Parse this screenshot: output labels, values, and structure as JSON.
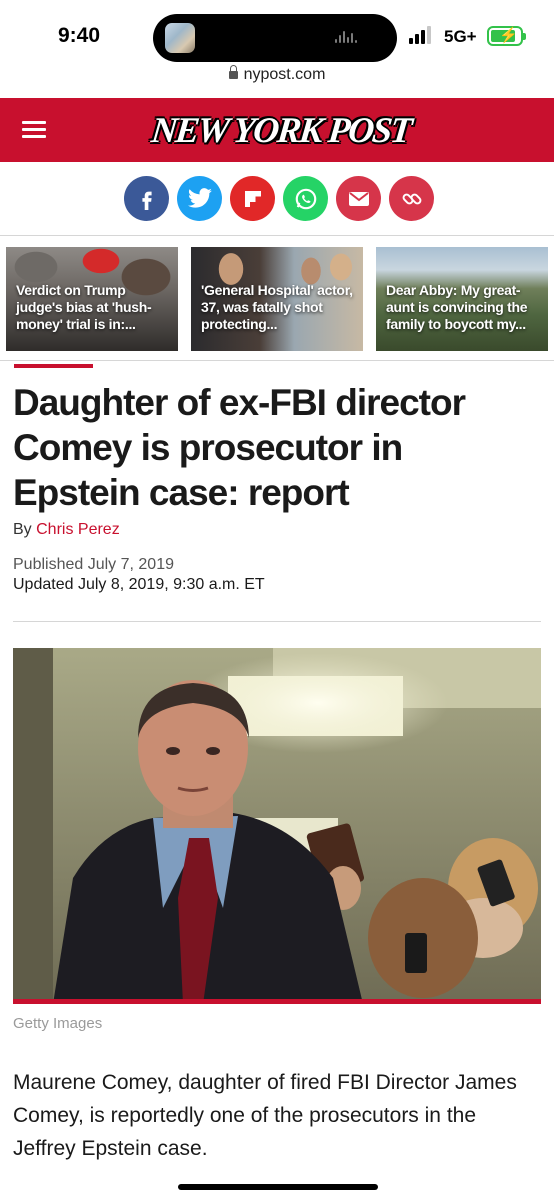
{
  "status_bar": {
    "time": "9:40",
    "network": "5G+",
    "battery_charging": true
  },
  "browser": {
    "url": "nypost.com"
  },
  "header": {
    "logo_text": "NEW YORK POST",
    "brand_color": "#c8102e"
  },
  "share_buttons": [
    {
      "name": "facebook",
      "glyph": "f",
      "color": "#3b5998"
    },
    {
      "name": "twitter",
      "glyph": "t",
      "color": "#1da1f2"
    },
    {
      "name": "flipboard",
      "glyph": "F",
      "color": "#e12828"
    },
    {
      "name": "whatsapp",
      "glyph": "w",
      "color": "#25d366"
    },
    {
      "name": "email",
      "glyph": "@",
      "color": "#d6354a"
    },
    {
      "name": "link",
      "glyph": "link",
      "color": "#d6354a"
    }
  ],
  "related_stories": [
    {
      "title": "Verdict on Trump judge's bias at 'hush-money' trial is in:..."
    },
    {
      "title": "'General Hospital' actor, 37, was fatally shot protecting..."
    },
    {
      "title": "Dear Abby: My great-aunt is convincing the family to boycott my..."
    }
  ],
  "article": {
    "headline": "Daughter of ex-FBI director Comey is prosecutor in Epstein case: report",
    "byline_prefix": "By",
    "author": "Chris Perez",
    "published": "Published July 7, 2019",
    "updated": "Updated July 8, 2019, 9:30 a.m. ET",
    "photo_credit": "Getty Images",
    "body_first_paragraph": "Maurene Comey, daughter of fired FBI Director James Comey, is reportedly one of the prosecutors in the Jeffrey Epstein case."
  }
}
